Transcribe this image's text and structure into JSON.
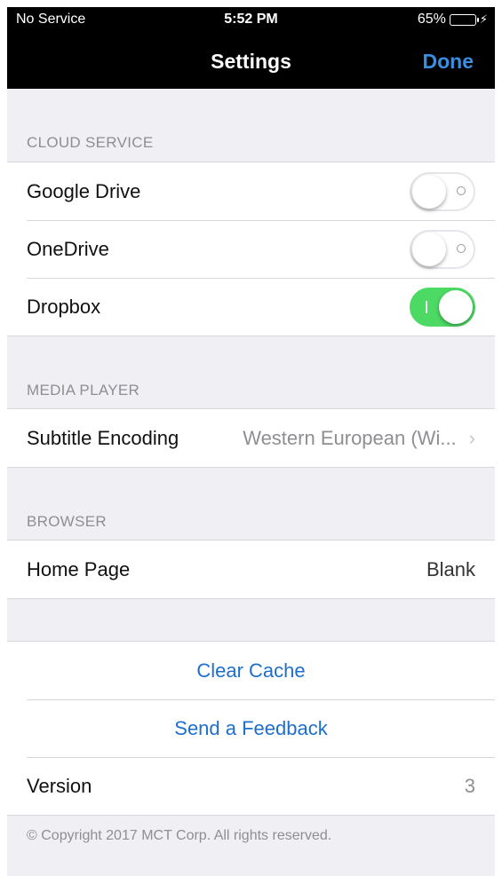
{
  "status_bar": {
    "carrier": "No Service",
    "time": "5:52 PM",
    "battery_percent": "65%",
    "battery_level": 0.65,
    "battery_color": "#4cd964"
  },
  "nav": {
    "title": "Settings",
    "done_label": "Done",
    "accent_color": "#3b8de0"
  },
  "cloud_service": {
    "header": "CLOUD SERVICE",
    "items": [
      {
        "label": "Google Drive",
        "enabled": false
      },
      {
        "label": "OneDrive",
        "enabled": false
      },
      {
        "label": "Dropbox",
        "enabled": true
      }
    ]
  },
  "media_player": {
    "header": "MEDIA PLAYER",
    "subtitle_encoding_label": "Subtitle Encoding",
    "subtitle_encoding_value": "Western European (Wi..."
  },
  "browser": {
    "header": "BROWSER",
    "home_page_label": "Home Page",
    "home_page_value": "Blank"
  },
  "actions": {
    "clear_cache": "Clear Cache",
    "send_feedback": "Send a Feedback",
    "version_label": "Version",
    "version_value": "3"
  },
  "footer": {
    "copyright": "© Copyright 2017 MCT Corp. All rights reserved."
  },
  "icons": {
    "chevron": "chevron-right-icon",
    "bolt": "charging-bolt-icon",
    "battery": "battery-icon"
  }
}
